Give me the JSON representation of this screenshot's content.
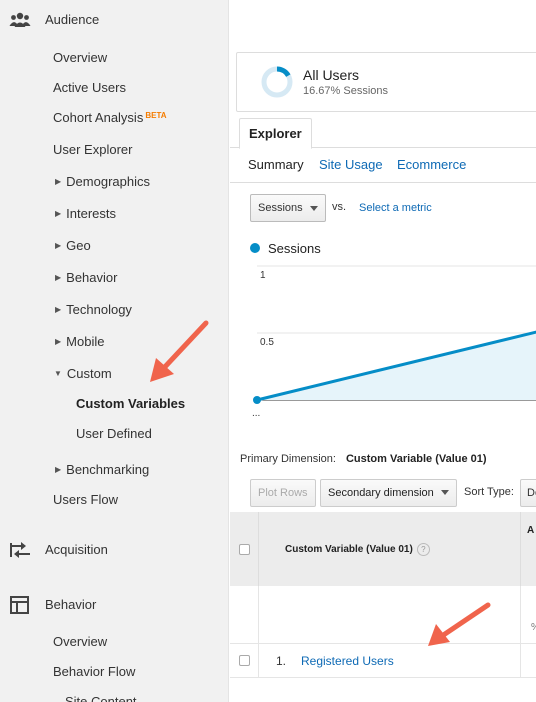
{
  "sidebar": {
    "sections": [
      {
        "label": "Audience",
        "icon": "audience-users-icon"
      },
      {
        "label": "Acquisition",
        "icon": "acquisition-arrows-icon"
      },
      {
        "label": "Behavior",
        "icon": "behavior-layout-icon"
      }
    ],
    "audience_items": {
      "overview": "Overview",
      "active_users": "Active Users",
      "cohort_analysis": "Cohort Analysis",
      "cohort_badge": "BETA",
      "user_explorer": "User Explorer",
      "demographics": "Demographics",
      "interests": "Interests",
      "geo": "Geo",
      "behavior": "Behavior",
      "technology": "Technology",
      "mobile": "Mobile",
      "custom": "Custom",
      "custom_variables": "Custom Variables",
      "user_defined": "User Defined",
      "benchmarking": "Benchmarking",
      "users_flow": "Users Flow"
    },
    "behavior_items": {
      "overview": "Overview",
      "behavior_flow": "Behavior Flow",
      "site_content": "Site Content"
    },
    "active_item": "Custom Variables"
  },
  "segment": {
    "name": "All Users",
    "subtitle": "16.67% Sessions",
    "fraction": 0.1667
  },
  "explorer_tab": "Explorer",
  "subtabs": {
    "summary": "Summary",
    "site_usage": "Site Usage",
    "ecommerce": "Ecommerce"
  },
  "metric": {
    "selected": "Sessions",
    "vs": "vs.",
    "select_link": "Select a metric"
  },
  "chart_data": {
    "type": "area",
    "series": [
      {
        "name": "Sessions",
        "values": [
          0,
          1
        ]
      }
    ],
    "y_ticks": [
      "1",
      "0.5"
    ],
    "x_tick_label": "...",
    "ylim": [
      0,
      1
    ],
    "color": "#058dc7"
  },
  "primary_dimension": {
    "label": "Primary Dimension:",
    "value": "Custom Variable (Value 01)"
  },
  "controls": {
    "plot_rows": "Plot Rows",
    "secondary_dimension": "Secondary dimension",
    "sort_type_label": "Sort Type:",
    "sort_type_value": "De"
  },
  "table": {
    "dimension_header": "Custom Variable (Value 01)",
    "help": "?",
    "next_header": "A",
    "totals_pct": "%",
    "rows": [
      {
        "num": "1.",
        "label": "Registered Users"
      }
    ]
  },
  "colors": {
    "link": "#0e6ab5",
    "series": "#058dc7",
    "annotation_arrow": "#f0644c",
    "beta": "#f57c00"
  }
}
